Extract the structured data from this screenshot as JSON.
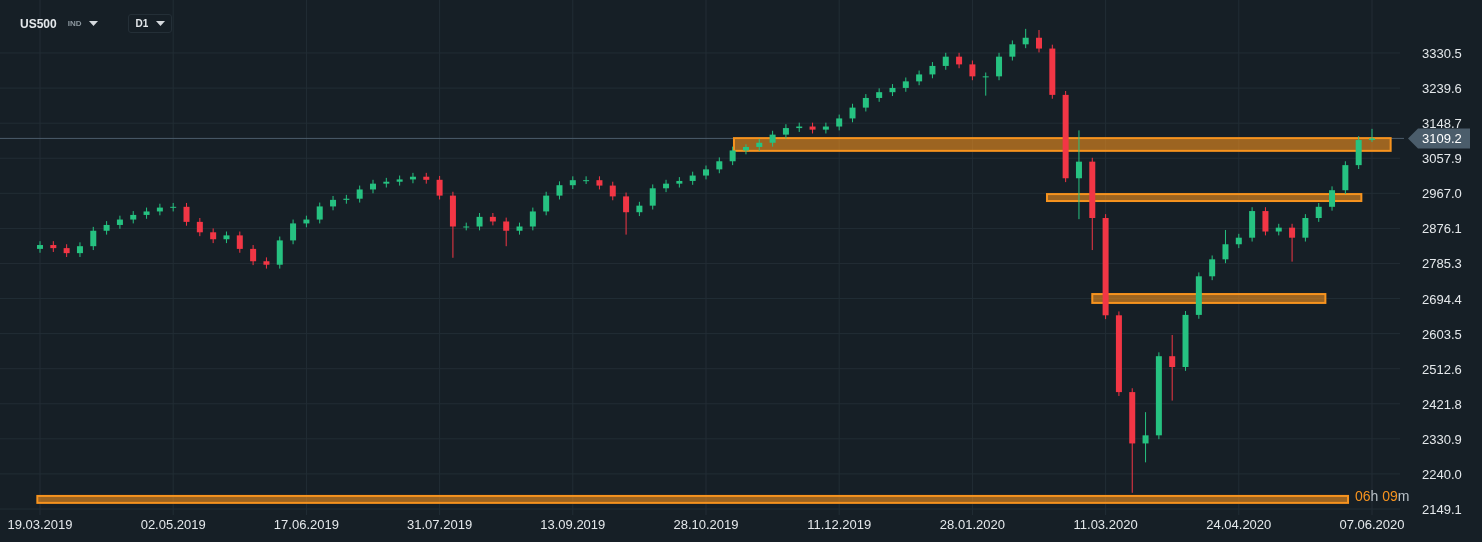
{
  "header": {
    "symbol": "US500",
    "market": "IND",
    "timeframe": "D1"
  },
  "chart": {
    "chart_data": {
      "type": "candlestick",
      "categories": [
        "19.03.2019",
        null,
        null,
        null,
        null,
        null,
        null,
        null,
        null,
        null,
        "02.05.2019",
        null,
        null,
        null,
        null,
        null,
        null,
        null,
        null,
        null,
        "17.06.2019",
        null,
        null,
        null,
        null,
        null,
        null,
        null,
        null,
        null,
        "31.07.2019",
        null,
        null,
        null,
        null,
        null,
        null,
        null,
        null,
        null,
        "13.09.2019",
        null,
        null,
        null,
        null,
        null,
        null,
        null,
        null,
        null,
        "28.10.2019",
        null,
        null,
        null,
        null,
        null,
        null,
        null,
        null,
        null,
        "11.12.2019",
        null,
        null,
        null,
        null,
        null,
        null,
        null,
        null,
        null,
        "28.01.2020",
        null,
        null,
        null,
        null,
        null,
        null,
        null,
        null,
        null,
        "11.03.2020",
        null,
        null,
        null,
        null,
        null,
        null,
        null,
        null,
        null,
        "24.04.2020",
        null,
        null,
        null,
        null,
        null,
        null,
        null,
        null,
        null,
        "07.06.2020"
      ],
      "ohlc": [
        [
          2823,
          2843,
          2813,
          2833
        ],
        [
          2833,
          2843,
          2815,
          2825
        ],
        [
          2825,
          2835,
          2802,
          2812
        ],
        [
          2812,
          2840,
          2802,
          2830
        ],
        [
          2830,
          2880,
          2820,
          2870
        ],
        [
          2870,
          2895,
          2860,
          2885
        ],
        [
          2885,
          2909,
          2875,
          2899
        ],
        [
          2899,
          2921,
          2889,
          2911
        ],
        [
          2911,
          2930,
          2901,
          2920
        ],
        [
          2920,
          2940,
          2910,
          2930
        ],
        [
          2930,
          2942,
          2920,
          2932
        ],
        [
          2932,
          2942,
          2883,
          2893
        ],
        [
          2893,
          2903,
          2856,
          2866
        ],
        [
          2866,
          2876,
          2838,
          2848
        ],
        [
          2848,
          2868,
          2838,
          2858
        ],
        [
          2858,
          2868,
          2813,
          2823
        ],
        [
          2823,
          2833,
          2781,
          2791
        ],
        [
          2791,
          2801,
          2772,
          2782
        ],
        [
          2782,
          2855,
          2772,
          2845
        ],
        [
          2845,
          2899,
          2835,
          2889
        ],
        [
          2889,
          2909,
          2879,
          2899
        ],
        [
          2899,
          2943,
          2889,
          2933
        ],
        [
          2933,
          2960,
          2923,
          2950
        ],
        [
          2950,
          2963,
          2940,
          2953
        ],
        [
          2953,
          2987,
          2943,
          2977
        ],
        [
          2977,
          3002,
          2967,
          2992
        ],
        [
          2992,
          3007,
          2982,
          2997
        ],
        [
          2997,
          3013,
          2987,
          3003
        ],
        [
          3003,
          3020,
          2993,
          3010
        ],
        [
          3010,
          3020,
          2992,
          3002
        ],
        [
          3002,
          3012,
          2951,
          2961
        ],
        [
          2961,
          2971,
          2800,
          2881
        ],
        [
          2881,
          2891,
          2871,
          2881
        ],
        [
          2881,
          2916,
          2871,
          2906
        ],
        [
          2906,
          2916,
          2884,
          2894
        ],
        [
          2894,
          2904,
          2830,
          2870
        ],
        [
          2870,
          2891,
          2860,
          2881
        ],
        [
          2881,
          2930,
          2871,
          2920
        ],
        [
          2920,
          2971,
          2910,
          2961
        ],
        [
          2961,
          2998,
          2951,
          2988
        ],
        [
          2988,
          3011,
          2978,
          3001
        ],
        [
          3001,
          3011,
          2991,
          3001
        ],
        [
          3001,
          3011,
          2977,
          2987
        ],
        [
          2987,
          2997,
          2949,
          2959
        ],
        [
          2959,
          2969,
          2860,
          2918
        ],
        [
          2918,
          2945,
          2908,
          2935
        ],
        [
          2935,
          2990,
          2925,
          2980
        ],
        [
          2980,
          3002,
          2970,
          2992
        ],
        [
          2992,
          3009,
          2982,
          2999
        ],
        [
          2999,
          3023,
          2989,
          3013
        ],
        [
          3013,
          3039,
          3003,
          3029
        ],
        [
          3029,
          3060,
          3019,
          3050
        ],
        [
          3050,
          3088,
          3040,
          3078
        ],
        [
          3078,
          3094,
          3068,
          3087
        ],
        [
          3087,
          3108,
          3077,
          3098
        ],
        [
          3098,
          3129,
          3088,
          3119
        ],
        [
          3119,
          3146,
          3109,
          3136
        ],
        [
          3136,
          3150,
          3126,
          3140
        ],
        [
          3140,
          3150,
          3122,
          3132
        ],
        [
          3132,
          3150,
          3122,
          3140
        ],
        [
          3140,
          3171,
          3130,
          3161
        ],
        [
          3161,
          3199,
          3151,
          3189
        ],
        [
          3189,
          3224,
          3179,
          3214
        ],
        [
          3214,
          3239,
          3204,
          3229
        ],
        [
          3229,
          3250,
          3219,
          3240
        ],
        [
          3240,
          3267,
          3230,
          3257
        ],
        [
          3257,
          3285,
          3247,
          3275
        ],
        [
          3275,
          3307,
          3265,
          3297
        ],
        [
          3297,
          3331,
          3287,
          3321
        ],
        [
          3321,
          3331,
          3291,
          3301
        ],
        [
          3301,
          3311,
          3260,
          3270
        ],
        [
          3270,
          3280,
          3220,
          3270
        ],
        [
          3270,
          3331,
          3260,
          3321
        ],
        [
          3321,
          3363,
          3311,
          3353
        ],
        [
          3353,
          3393,
          3343,
          3370
        ],
        [
          3370,
          3390,
          3332,
          3342
        ],
        [
          3342,
          3352,
          3212,
          3222
        ],
        [
          3222,
          3232,
          2996,
          3006
        ],
        [
          3006,
          3130,
          2900,
          3049
        ],
        [
          3049,
          3059,
          2820,
          2903
        ],
        [
          2903,
          2913,
          2641,
          2651
        ],
        [
          2651,
          2661,
          2442,
          2452
        ],
        [
          2452,
          2462,
          2191,
          2319
        ],
        [
          2319,
          2400,
          2270,
          2340
        ],
        [
          2340,
          2555,
          2330,
          2545
        ],
        [
          2545,
          2600,
          2430,
          2517
        ],
        [
          2517,
          2662,
          2507,
          2652
        ],
        [
          2652,
          2762,
          2642,
          2752
        ],
        [
          2752,
          2806,
          2742,
          2796
        ],
        [
          2796,
          2872,
          2786,
          2835
        ],
        [
          2835,
          2862,
          2825,
          2852
        ],
        [
          2852,
          2931,
          2842,
          2921
        ],
        [
          2921,
          2931,
          2858,
          2868
        ],
        [
          2868,
          2888,
          2858,
          2878
        ],
        [
          2878,
          2888,
          2790,
          2852
        ],
        [
          2852,
          2913,
          2842,
          2903
        ],
        [
          2903,
          2942,
          2893,
          2932
        ],
        [
          2932,
          2985,
          2922,
          2975
        ],
        [
          2975,
          3050,
          2965,
          3040
        ],
        [
          3040,
          3115,
          3030,
          3105
        ],
        [
          3105,
          3134,
          3100,
          3109
        ]
      ],
      "grid": true,
      "ylim": [
        2133.6,
        3467.8
      ],
      "yticks": [
        {
          "value": 3330.5,
          "label": "3330.5"
        },
        {
          "value": 3239.6,
          "label": "3239.6"
        },
        {
          "value": 3148.7,
          "label": "3148.7"
        },
        {
          "value": 3057.9,
          "label": "3057.9"
        },
        {
          "value": 2967.0,
          "label": "2967.0"
        },
        {
          "value": 2876.1,
          "label": "2876.1"
        },
        {
          "value": 2785.3,
          "label": "2785.3"
        },
        {
          "value": 2694.4,
          "label": "2694.4"
        },
        {
          "value": 2603.5,
          "label": "2603.5"
        },
        {
          "value": 2512.6,
          "label": "2512.6"
        },
        {
          "value": 2421.8,
          "label": "2421.8"
        },
        {
          "value": 2330.9,
          "label": "2330.9"
        },
        {
          "value": 2240.0,
          "label": "2240.0"
        },
        {
          "value": 2149.1,
          "label": "2149.1"
        }
      ],
      "bands": [
        {
          "axis": "y",
          "from": 3077,
          "to": 3110
        },
        {
          "axis": "y",
          "from": 2947,
          "to": 2965
        },
        {
          "axis": "y",
          "from": 2683,
          "to": 2706
        },
        {
          "axis": "y",
          "from": 2165,
          "to": 2183
        }
      ],
      "ref_lines": [
        {
          "axis": "y",
          "value": 3109.2,
          "label": "3109.2"
        }
      ]
    }
  },
  "countdown": {
    "hours": "06",
    "hours_unit": "h",
    "minutes": "09",
    "minutes_unit": "m"
  }
}
